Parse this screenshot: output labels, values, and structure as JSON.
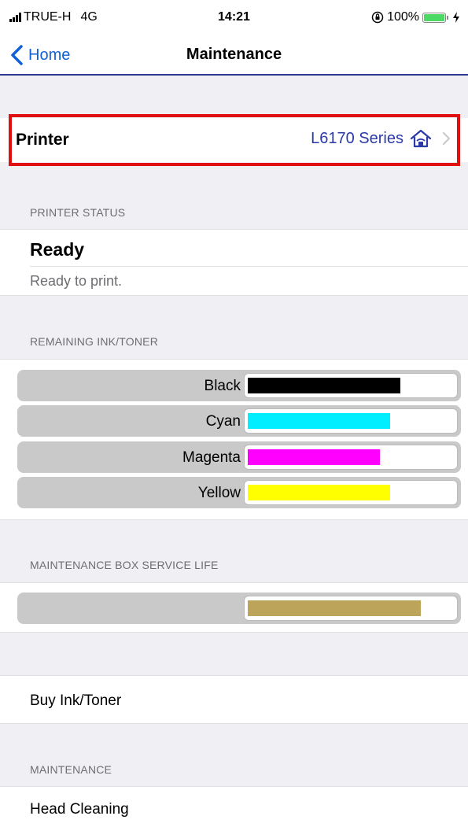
{
  "status_bar": {
    "carrier": "TRUE-H",
    "network": "4G",
    "time": "14:21",
    "battery": "100%",
    "icons": [
      "signal-icon",
      "orientation-lock-icon",
      "battery-icon",
      "charging-icon"
    ]
  },
  "nav": {
    "back_label": "Home",
    "title": "Maintenance",
    "accent_color": "#1060d8",
    "border_color": "#2b3a8f"
  },
  "printer": {
    "label": "Printer",
    "value": "L6170 Series",
    "icon": "home-network-icon",
    "highlight_color": "#e01010"
  },
  "printer_status": {
    "header": "PRINTER STATUS",
    "title": "Ready",
    "description": "Ready to print."
  },
  "ink": {
    "header": "REMAINING INK/TONER",
    "levels": [
      {
        "name": "Black",
        "color": "#000000",
        "level": 0.74
      },
      {
        "name": "Cyan",
        "color": "#00eeff",
        "level": 0.69
      },
      {
        "name": "Magenta",
        "color": "#ff00ff",
        "level": 0.64
      },
      {
        "name": "Yellow",
        "color": "#ffff00",
        "level": 0.69
      }
    ]
  },
  "maintenance_box": {
    "header": "MAINTENANCE BOX SERVICE LIFE",
    "color": "#bca55a",
    "level": 0.84
  },
  "buy": {
    "label": "Buy Ink/Toner"
  },
  "maintenance": {
    "header": "MAINTENANCE",
    "items": [
      {
        "label": "Head Cleaning"
      }
    ]
  }
}
